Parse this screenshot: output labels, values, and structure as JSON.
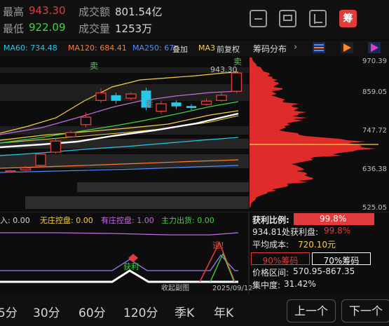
{
  "header": {
    "high_label": "最高",
    "high_value": "943.30",
    "low_label": "最低",
    "low_value": "922.09",
    "turnover_label": "成交额",
    "turnover_value": "801.54亿",
    "volume_label": "成交量",
    "volume_value": "1253万",
    "tool_icons": [
      "minus-box-icon",
      "screen-icon",
      "area-icon",
      "chip-icon"
    ],
    "active_tool_label": "筹"
  },
  "ma_bar": {
    "ma60": "MA60: 734.48",
    "ma120": "MA120: 684.41",
    "ma250": "MA250: 67",
    "overlay": "叠加",
    "ma3": "MA3",
    "adjust": "前复权",
    "chip_dist": "筹码分布",
    "chevron": "›"
  },
  "main_chart": {
    "price_ticks": [
      "970.39",
      "859.05",
      "747.72",
      "636.38",
      "525.05"
    ],
    "last_high_label": "943.30",
    "sell_label_1": "卖",
    "sell_label_2": "卖",
    "sell_label_3": "卖",
    "candles": [
      {
        "o": 634,
        "c": 637,
        "h": 640,
        "l": 632
      },
      {
        "o": 640,
        "c": 646,
        "h": 652,
        "l": 636
      },
      {
        "o": 654,
        "c": 688,
        "h": 694,
        "l": 650
      },
      {
        "o": 694,
        "c": 728,
        "h": 738,
        "l": 690
      },
      {
        "o": 741,
        "c": 754,
        "h": 760,
        "l": 737
      },
      {
        "o": 778,
        "c": 801,
        "h": 815,
        "l": 770
      },
      {
        "o": 852,
        "c": 875,
        "h": 890,
        "l": 845
      },
      {
        "o": 868,
        "c": 851,
        "h": 876,
        "l": 842
      },
      {
        "o": 859,
        "c": 872,
        "h": 877,
        "l": 853
      },
      {
        "o": 882,
        "c": 830,
        "h": 891,
        "l": 822
      },
      {
        "o": 819,
        "c": 842,
        "h": 851,
        "l": 811
      },
      {
        "o": 846,
        "c": 834,
        "h": 852,
        "l": 826
      },
      {
        "o": 835,
        "c": 829,
        "h": 841,
        "l": 823
      },
      {
        "o": 840,
        "c": 850,
        "h": 858,
        "l": 836
      },
      {
        "o": 852,
        "c": 868,
        "h": 875,
        "l": 848
      },
      {
        "o": 880,
        "c": 936,
        "h": 943.3,
        "l": 874
      }
    ]
  },
  "chip_panel": {
    "profit_ratio_label": "获利比例:",
    "profit_ratio_value": "99.8%",
    "profit_line_label": "934.81处获利盘:",
    "profit_line_value": "99.8%",
    "avg_cost_label": "平均成本:",
    "avg_cost_value": "720.10元",
    "chip90": "90%筹码",
    "chip70": "70%筹码",
    "price_range_label": "价格区间:",
    "price_range_value": "570.95-867.35",
    "concentration_label": "集中度:",
    "concentration_value": "31.42%"
  },
  "sub_chart": {
    "label_a": "入: 0.00",
    "label_b": "无庄控盘: 0.00",
    "label_c": "有庄控盘: 1.00",
    "label_d": "主力出货: 0.00",
    "escape_label": "逃!",
    "profit_label": "获利",
    "collapse_label": "收起副图",
    "date_label": "2025/09/12"
  },
  "bottom_nav": {
    "periods": [
      "5分",
      "30分",
      "60分",
      "120分",
      "季K",
      "年K"
    ],
    "prev_label": "上一个",
    "next_label": "下一个"
  },
  "colors": {
    "up": "#e23b3b",
    "down": "#25c8e8",
    "yellow": "#f5d142",
    "green": "#3ed63e",
    "purple": "#c36ce0",
    "white": "#ffffff"
  }
}
